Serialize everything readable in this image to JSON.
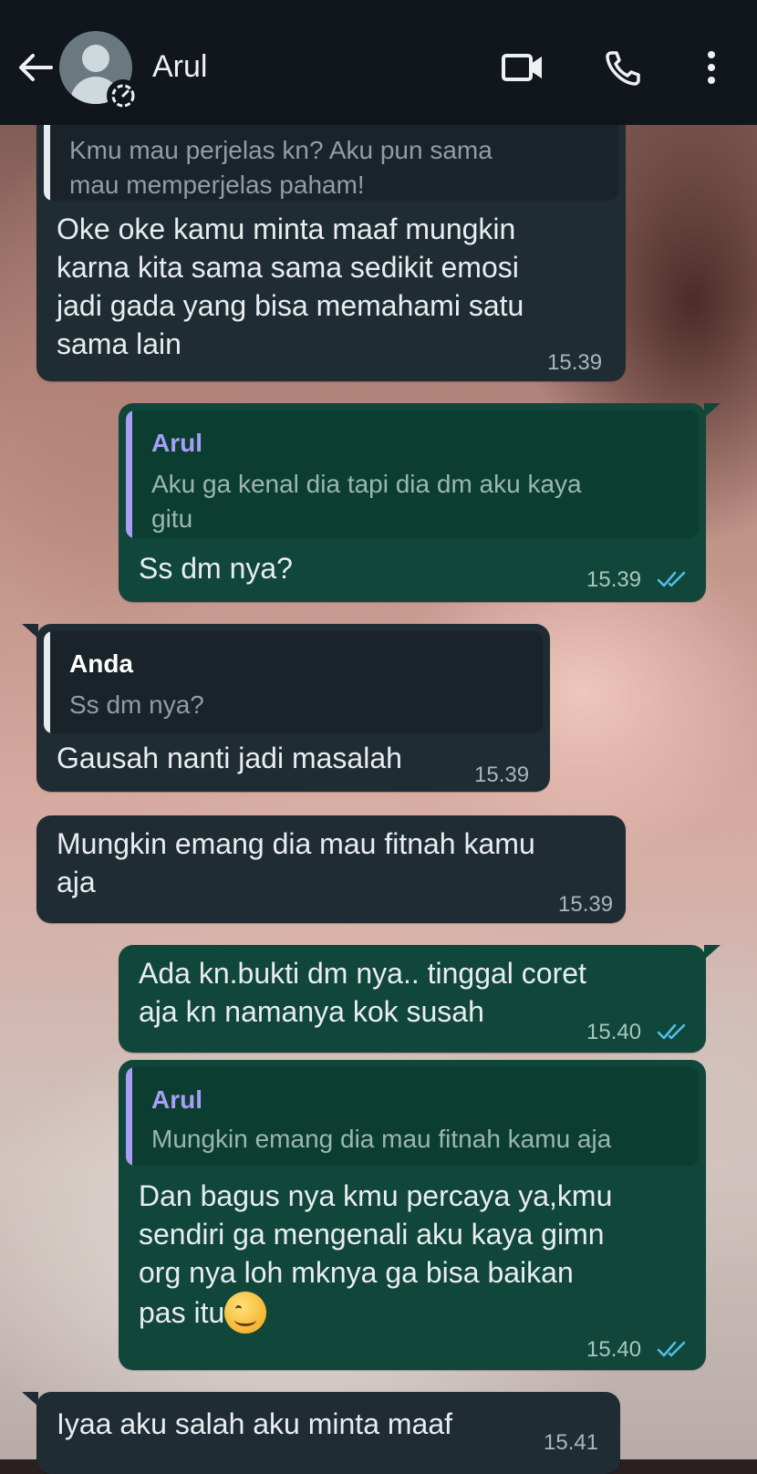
{
  "header": {
    "contact_name": "Arul"
  },
  "messages": [
    {
      "direction": "incoming",
      "quote_text": "Kmu mau perjelas kn? Aku pun sama\nmau memperjelas paham!",
      "text": "Oke oke kamu minta maaf mungkin\nkarna kita sama sama sedikit emosi\njadi gada yang bisa memahami satu\nsama lain",
      "time": "15.39"
    },
    {
      "direction": "outgoing",
      "quote_name": "Arul",
      "quote_text": "Aku ga kenal dia tapi dia dm aku kaya\ngitu",
      "text": "Ss dm nya?",
      "time": "15.39",
      "status": "read"
    },
    {
      "direction": "incoming",
      "quote_name": "Anda",
      "quote_text": "Ss dm nya?",
      "text": "Gausah nanti jadi masalah",
      "time": "15.39"
    },
    {
      "direction": "incoming",
      "text": "Mungkin emang dia mau fitnah kamu\naja",
      "time": "15.39"
    },
    {
      "direction": "outgoing",
      "text": "Ada kn.bukti dm nya.. tinggal coret\naja kn namanya kok susah",
      "time": "15.40",
      "status": "read"
    },
    {
      "direction": "outgoing",
      "quote_name": "Arul",
      "quote_text": "Mungkin emang dia mau fitnah kamu aja",
      "text": "Dan bagus nya kmu percaya ya,kmu\nsendiri ga mengenali aku kaya gimn\norg nya loh mknya ga bisa baikan\npas itu",
      "emoji": "smiling-face-emoji",
      "time": "15.40",
      "status": "read"
    },
    {
      "direction": "incoming",
      "text": "Iyaa aku salah aku minta maaf",
      "time": "15.41"
    }
  ],
  "colors": {
    "header_bg": "#10161b",
    "incoming_bubble": "#202c33",
    "outgoing_bubble": "#10473a",
    "quote_name_arul": "#a79ff5",
    "quote_name_anda": "#ffffff",
    "read_ticks": "#53bdeb"
  },
  "icons": [
    "back-arrow-icon",
    "avatar-placeholder-icon",
    "status-icon",
    "video-call-icon",
    "phone-call-icon",
    "more-options-icon",
    "read-ticks-icon"
  ]
}
